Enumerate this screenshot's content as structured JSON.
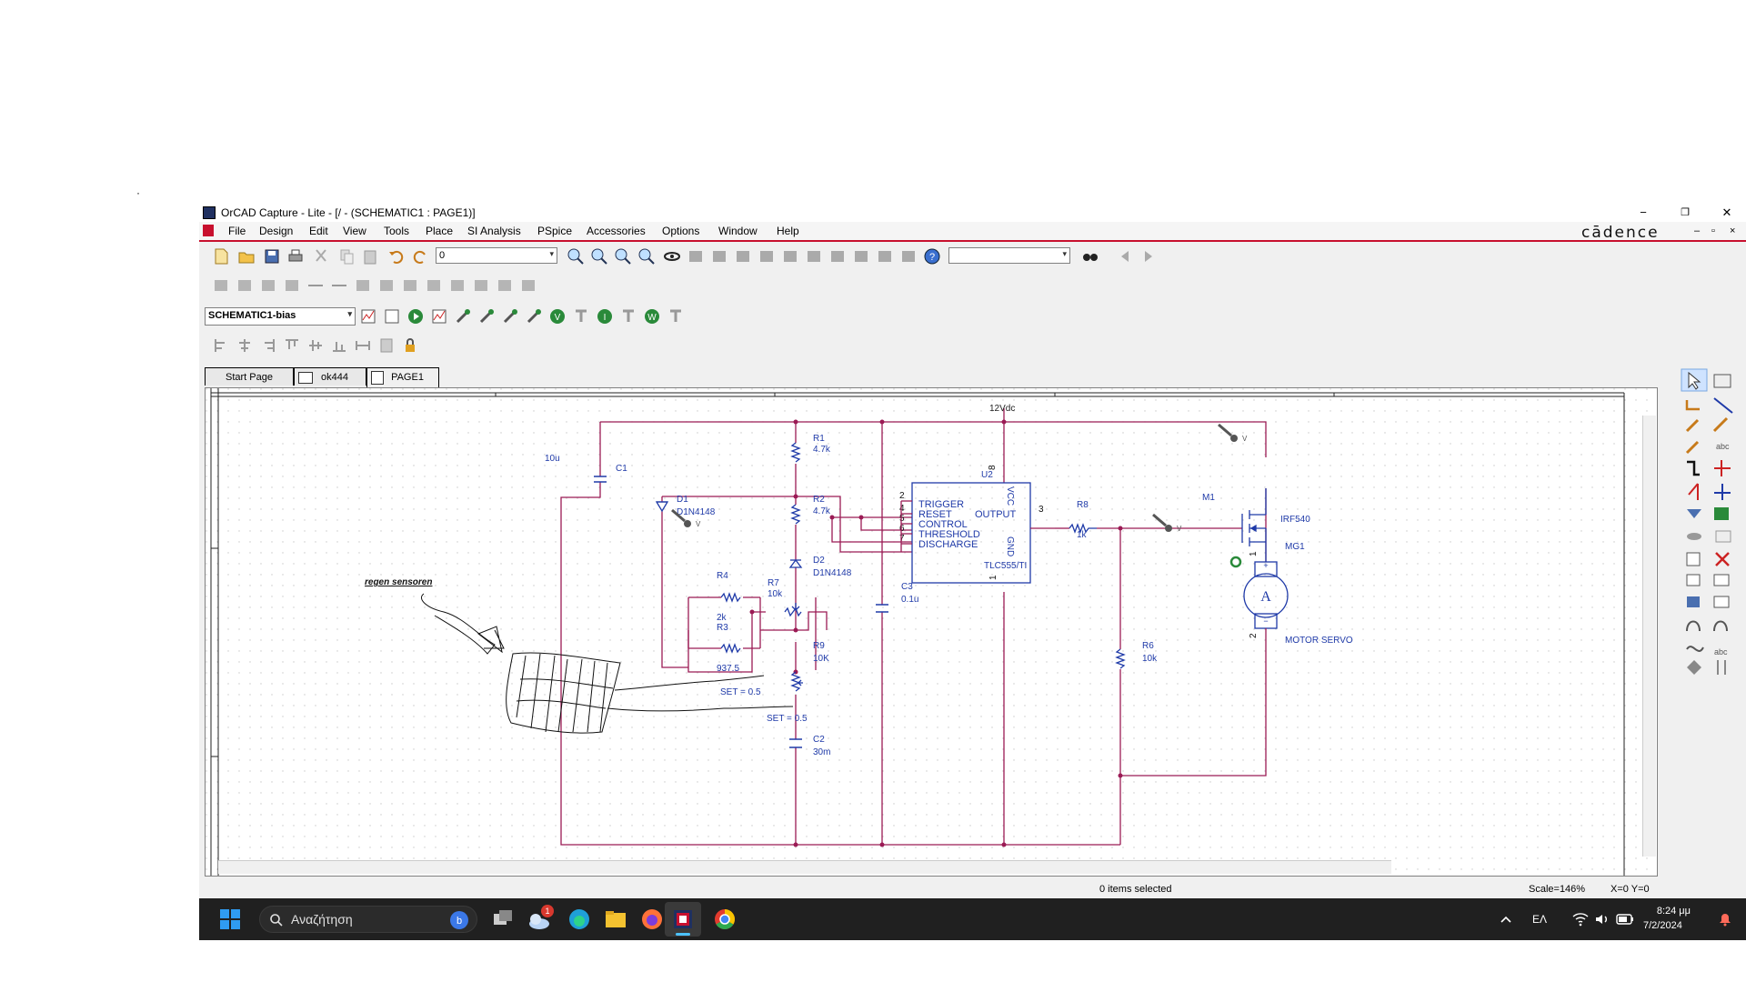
{
  "window": {
    "title": "OrCAD Capture - Lite - [/ - (SCHEMATIC1 : PAGE1)]",
    "minimize": "−",
    "maximize": "❐",
    "close": "✕"
  },
  "menu": [
    "File",
    "Design",
    "Edit",
    "View",
    "Tools",
    "Place",
    "SI Analysis",
    "PSpice",
    "Accessories",
    "Options",
    "Window",
    "Help"
  ],
  "brand": "cādence",
  "mdi_controls": [
    "–",
    "▫",
    "×"
  ],
  "toolbar": {
    "part_combo_value": "0",
    "find_combo_value": "",
    "profile_combo_value": "SCHEMATIC1-bias"
  },
  "tabs": [
    "Start Page",
    "ok444",
    "PAGE1"
  ],
  "schematic": {
    "supply_label": "12Vdc",
    "components": {
      "R1": {
        "ref": "R1",
        "value": "4.7k"
      },
      "R2": {
        "ref": "R2",
        "value": "4.7k"
      },
      "C1": {
        "ref": "C1",
        "value": "10u"
      },
      "D1": {
        "ref": "D1",
        "value": "D1N4148"
      },
      "D2": {
        "ref": "D2",
        "value": "D1N4148"
      },
      "R4": {
        "ref": "R4",
        "value": "2k"
      },
      "R3": {
        "ref": "R3",
        "value": "937.5"
      },
      "R7": {
        "ref": "R7",
        "value": "10k"
      },
      "R9": {
        "ref": "R9",
        "value": "10K"
      },
      "R9_set": "SET = 0.5",
      "R7_set": "SET = 0.5",
      "C2": {
        "ref": "C2",
        "value": "30m"
      },
      "C3": {
        "ref": "C3",
        "value": "0.1u"
      },
      "U2": {
        "ref": "U2",
        "value": "TLC555/TI"
      },
      "R8": {
        "ref": "R8",
        "value": "1k"
      },
      "M1": {
        "ref": "M1",
        "value": "IRF540"
      },
      "R6": {
        "ref": "R6",
        "value": "10k"
      },
      "MG1": {
        "ref": "MG1",
        "value": "MOTOR SERVO"
      }
    },
    "ic_pins": {
      "trigger": "TRIGGER",
      "reset": "RESET",
      "control": "CONTROL",
      "threshold": "THRESHOLD",
      "discharge": "DISCHARGE",
      "output": "OUTPUT",
      "vcc": "VCC",
      "gnd": "GND",
      "pin2": "2",
      "pin4": "4",
      "pin5": "5",
      "pin6": "6",
      "pin7": "7",
      "pin3": "3",
      "pin8": "8",
      "pin1": "1"
    },
    "motor_symbol": "A",
    "motor_pin1": "1",
    "motor_pin2": "2",
    "annotation": "regen sensoren",
    "probe_label": "V"
  },
  "status": {
    "selection": "0 items selected",
    "scale": "Scale=146%",
    "coords": "X=0  Y=0"
  },
  "taskbar": {
    "search_placeholder": "Αναζήτηση",
    "weather_badge": "1",
    "language": "ΕΛ",
    "time": "8:24 μμ",
    "date": "7/2/2024"
  },
  "colors": {
    "wire": "#9b1b55",
    "component": "#1f3aa8",
    "text": "#1f3aa8",
    "accent": "#c8102e"
  }
}
